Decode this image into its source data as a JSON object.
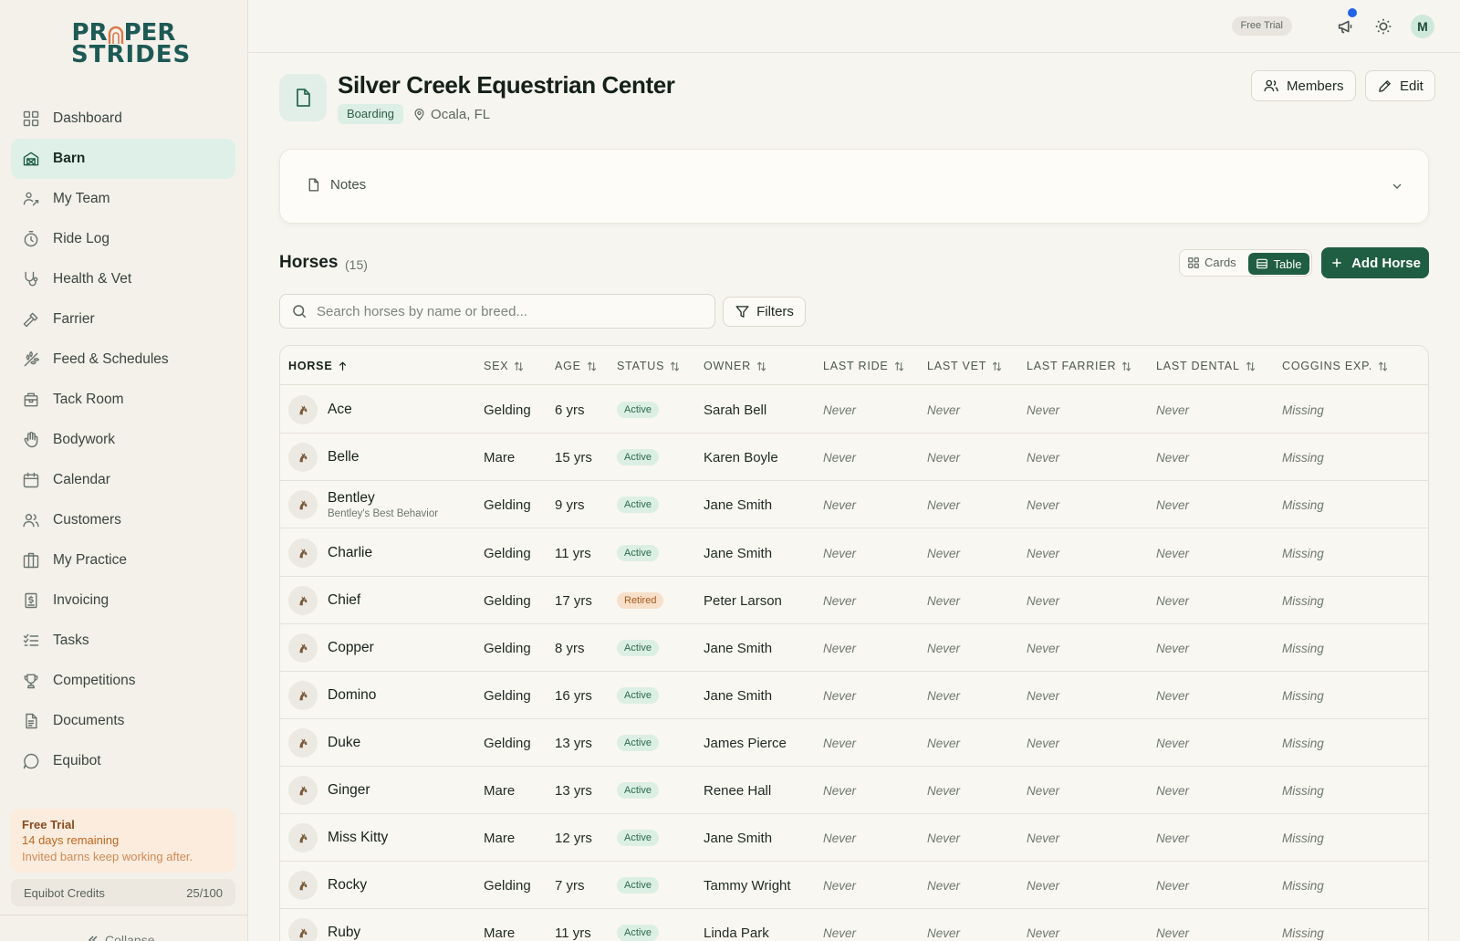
{
  "brand": {
    "line1_left": "PR",
    "line1_right": "PER",
    "line2": "STRIDES"
  },
  "nav": [
    {
      "label": "Dashboard",
      "icon": "dashboard-icon"
    },
    {
      "label": "Barn",
      "icon": "barn-icon",
      "active": true
    },
    {
      "label": "My Team",
      "icon": "team-icon"
    },
    {
      "label": "Ride Log",
      "icon": "stopwatch-icon"
    },
    {
      "label": "Health & Vet",
      "icon": "stethoscope-icon"
    },
    {
      "label": "Farrier",
      "icon": "hammer-icon"
    },
    {
      "label": "Feed & Schedules",
      "icon": "wheat-icon"
    },
    {
      "label": "Tack Room",
      "icon": "box-icon"
    },
    {
      "label": "Bodywork",
      "icon": "hand-icon"
    },
    {
      "label": "Calendar",
      "icon": "calendar-icon"
    },
    {
      "label": "Customers",
      "icon": "users-icon"
    },
    {
      "label": "My Practice",
      "icon": "building-icon"
    },
    {
      "label": "Invoicing",
      "icon": "receipt-icon"
    },
    {
      "label": "Tasks",
      "icon": "checklist-icon"
    },
    {
      "label": "Competitions",
      "icon": "trophy-icon"
    },
    {
      "label": "Documents",
      "icon": "document-icon"
    },
    {
      "label": "Equibot",
      "icon": "chat-icon"
    }
  ],
  "trial": {
    "title": "Free Trial",
    "remaining": "14 days remaining",
    "note": "Invited barns keep working after."
  },
  "credits": {
    "label": "Equibot Credits",
    "value": "25/100"
  },
  "collapse_label": "Collapse",
  "topbar": {
    "free_trial": "Free Trial",
    "avatar_initial": "M"
  },
  "barn": {
    "name": "Silver Creek Equestrian Center",
    "tag": "Boarding",
    "location": "Ocala, FL"
  },
  "actions": {
    "members": "Members",
    "edit": "Edit"
  },
  "notes_label": "Notes",
  "horses": {
    "title": "Horses",
    "count": "(15)",
    "view_cards": "Cards",
    "view_table": "Table",
    "add": "Add Horse",
    "search_placeholder": "Search horses by name or breed...",
    "filters": "Filters",
    "columns": [
      "HORSE",
      "SEX",
      "AGE",
      "STATUS",
      "OWNER",
      "LAST RIDE",
      "LAST VET",
      "LAST FARRIER",
      "LAST DENTAL",
      "COGGINS EXP."
    ],
    "rows": [
      {
        "name": "Ace",
        "sub": "",
        "sex": "Gelding",
        "age": "6 yrs",
        "status": "Active",
        "owner": "Sarah Bell",
        "last_ride": "Never",
        "last_vet": "Never",
        "last_farrier": "Never",
        "last_dental": "Never",
        "coggins": "Missing"
      },
      {
        "name": "Belle",
        "sub": "",
        "sex": "Mare",
        "age": "15 yrs",
        "status": "Active",
        "owner": "Karen Boyle",
        "last_ride": "Never",
        "last_vet": "Never",
        "last_farrier": "Never",
        "last_dental": "Never",
        "coggins": "Missing"
      },
      {
        "name": "Bentley",
        "sub": "Bentley's Best Behavior",
        "sex": "Gelding",
        "age": "9 yrs",
        "status": "Active",
        "owner": "Jane Smith",
        "last_ride": "Never",
        "last_vet": "Never",
        "last_farrier": "Never",
        "last_dental": "Never",
        "coggins": "Missing"
      },
      {
        "name": "Charlie",
        "sub": "",
        "sex": "Gelding",
        "age": "11 yrs",
        "status": "Active",
        "owner": "Jane Smith",
        "last_ride": "Never",
        "last_vet": "Never",
        "last_farrier": "Never",
        "last_dental": "Never",
        "coggins": "Missing"
      },
      {
        "name": "Chief",
        "sub": "",
        "sex": "Gelding",
        "age": "17 yrs",
        "status": "Retired",
        "owner": "Peter Larson",
        "last_ride": "Never",
        "last_vet": "Never",
        "last_farrier": "Never",
        "last_dental": "Never",
        "coggins": "Missing"
      },
      {
        "name": "Copper",
        "sub": "",
        "sex": "Gelding",
        "age": "8 yrs",
        "status": "Active",
        "owner": "Jane Smith",
        "last_ride": "Never",
        "last_vet": "Never",
        "last_farrier": "Never",
        "last_dental": "Never",
        "coggins": "Missing"
      },
      {
        "name": "Domino",
        "sub": "",
        "sex": "Gelding",
        "age": "16 yrs",
        "status": "Active",
        "owner": "Jane Smith",
        "last_ride": "Never",
        "last_vet": "Never",
        "last_farrier": "Never",
        "last_dental": "Never",
        "coggins": "Missing"
      },
      {
        "name": "Duke",
        "sub": "",
        "sex": "Gelding",
        "age": "13 yrs",
        "status": "Active",
        "owner": "James Pierce",
        "last_ride": "Never",
        "last_vet": "Never",
        "last_farrier": "Never",
        "last_dental": "Never",
        "coggins": "Missing"
      },
      {
        "name": "Ginger",
        "sub": "",
        "sex": "Mare",
        "age": "13 yrs",
        "status": "Active",
        "owner": "Renee Hall",
        "last_ride": "Never",
        "last_vet": "Never",
        "last_farrier": "Never",
        "last_dental": "Never",
        "coggins": "Missing"
      },
      {
        "name": "Miss Kitty",
        "sub": "",
        "sex": "Mare",
        "age": "12 yrs",
        "status": "Active",
        "owner": "Jane Smith",
        "last_ride": "Never",
        "last_vet": "Never",
        "last_farrier": "Never",
        "last_dental": "Never",
        "coggins": "Missing"
      },
      {
        "name": "Rocky",
        "sub": "",
        "sex": "Gelding",
        "age": "7 yrs",
        "status": "Active",
        "owner": "Tammy Wright",
        "last_ride": "Never",
        "last_vet": "Never",
        "last_farrier": "Never",
        "last_dental": "Never",
        "coggins": "Missing"
      },
      {
        "name": "Ruby",
        "sub": "",
        "sex": "Mare",
        "age": "11 yrs",
        "status": "Active",
        "owner": "Linda Park",
        "last_ride": "Never",
        "last_vet": "Never",
        "last_farrier": "Never",
        "last_dental": "Never",
        "coggins": "Missing"
      }
    ]
  },
  "colors": {
    "brand_green": "#1f5e42",
    "logo_teal": "#1e5a55",
    "logo_arch": "#d9784a",
    "active_nav_bg": "#def0e8",
    "notification": "#2463eb"
  }
}
